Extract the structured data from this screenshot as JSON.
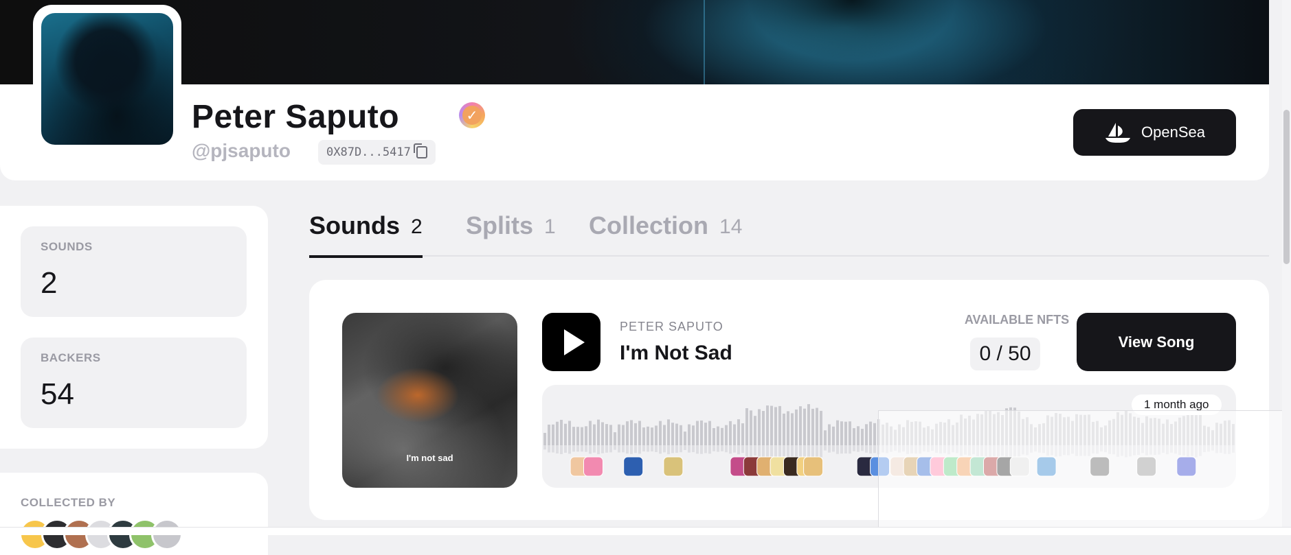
{
  "profile": {
    "name": "Peter Saputo",
    "handle": "@pjsaputo",
    "address": "0X87D...5417",
    "verified_icon": "verified-badge-icon"
  },
  "actions": {
    "opensea_label": "OpenSea"
  },
  "stats": [
    {
      "label": "SOUNDS",
      "value": "2"
    },
    {
      "label": "BACKERS",
      "value": "54"
    }
  ],
  "collected": {
    "label": "COLLECTED BY",
    "colors": [
      "#f7c64b",
      "#2d2d30",
      "#b07050",
      "#dcdce0",
      "#2e3b40",
      "#8fc26a",
      "#c7c7cc"
    ]
  },
  "tabs": [
    {
      "label": "Sounds",
      "count": "2",
      "active": true
    },
    {
      "label": "Splits",
      "count": "1",
      "active": false
    },
    {
      "label": "Collection",
      "count": "14",
      "active": false
    }
  ],
  "song": {
    "cover_text": "I'm not sad",
    "artist": "PETER SAPUTO",
    "title": "I'm Not Sad",
    "available_label": "AVAILABLE NFTS",
    "available_value": "0 / 50",
    "view_label": "View Song",
    "posted": "1 month ago"
  },
  "backer_avatars": {
    "positions": [
      0.03,
      0.05,
      0.11,
      0.17,
      0.27,
      0.29,
      0.31,
      0.33,
      0.35,
      0.37,
      0.38,
      0.46,
      0.48,
      0.51,
      0.53,
      0.55,
      0.57,
      0.59,
      0.61,
      0.63,
      0.65,
      0.67,
      0.69,
      0.73,
      0.81,
      0.88,
      0.94
    ],
    "colors": [
      "#f0c7a0",
      "#f28ab0",
      "#2d5fb0",
      "#d9c27a",
      "#c44c8a",
      "#8b3a3a",
      "#e0b070",
      "#f0e0a0",
      "#3a2a20",
      "#f2d080",
      "#e7c07a",
      "#2a2a40",
      "#5a8fe0",
      "#e8d0c0",
      "#caa060",
      "#3a6fd0",
      "#ff8bb0",
      "#6fd08a",
      "#f0a060",
      "#7acaa0",
      "#b04040",
      "#3a3a3a",
      "#dddddd",
      "#3a8ad0",
      "#6a6a6a",
      "#9a9a9a",
      "#3a4ad0"
    ]
  }
}
